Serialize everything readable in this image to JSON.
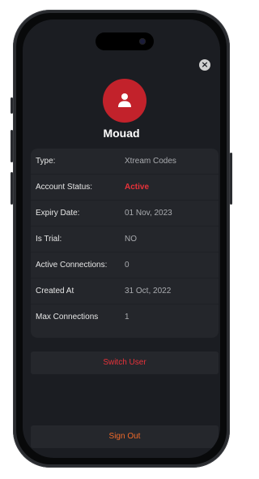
{
  "profile": {
    "username": "Mouad"
  },
  "details": [
    {
      "label": "Type:",
      "value": "Xtream Codes",
      "highlight": false
    },
    {
      "label": "Account Status:",
      "value": "Active",
      "highlight": true
    },
    {
      "label": "Expiry Date:",
      "value": "01 Nov, 2023",
      "highlight": false
    },
    {
      "label": "Is Trial:",
      "value": "NO",
      "highlight": false
    },
    {
      "label": "Active Connections:",
      "value": "0",
      "highlight": false
    },
    {
      "label": "Created At",
      "value": "31 Oct, 2022",
      "highlight": false
    },
    {
      "label": "Max Connections",
      "value": "1",
      "highlight": false
    }
  ],
  "actions": {
    "switch_user_label": "Switch User",
    "sign_out_label": "Sign Out"
  },
  "icons": {
    "close": "close-icon",
    "avatar": "user-icon"
  },
  "colors": {
    "accent_red": "#c2222b",
    "active_red": "#e8323a",
    "sign_out_orange": "#f06a2a",
    "background": "#1b1d22"
  }
}
